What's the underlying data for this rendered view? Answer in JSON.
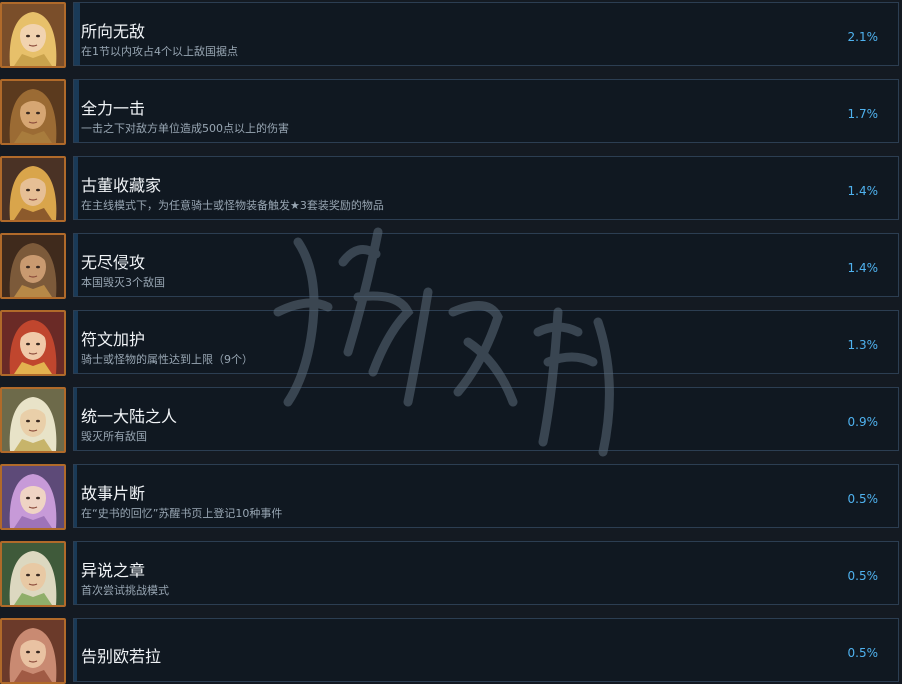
{
  "achievements": [
    {
      "title": "所向无敌",
      "description": "在1节以内攻占4个以上敌国据点",
      "percent": "2.1%",
      "progress": 0.021,
      "portrait": {
        "hair": "#e7c06a",
        "skin": "#f1d3b0",
        "bg": "#7a4e2a",
        "accent": "#c9a24c"
      }
    },
    {
      "title": "全力一击",
      "description": "一击之下对敌方单位造成500点以上的伤害",
      "percent": "1.7%",
      "progress": 0.017,
      "portrait": {
        "hair": "#9b6b34",
        "skin": "#d6a673",
        "bg": "#5b3a1e",
        "accent": "#a87c3d"
      }
    },
    {
      "title": "古董收藏家",
      "description": "在主线模式下，为任意骑士或怪物装备触发★3套装奖励的物品",
      "percent": "1.4%",
      "progress": 0.014,
      "portrait": {
        "hair": "#d9a54b",
        "skin": "#e6bf95",
        "bg": "#4a3225",
        "accent": "#8c5a2c"
      }
    },
    {
      "title": "无尽侵攻",
      "description": "本国毁灭3个敌国",
      "percent": "1.4%",
      "progress": 0.014,
      "portrait": {
        "hair": "#7c5a3a",
        "skin": "#c99a70",
        "bg": "#3f2a1c",
        "accent": "#b78947"
      }
    },
    {
      "title": "符文加护",
      "description": "骑士或怪物的属性达到上限（9个）",
      "percent": "1.3%",
      "progress": 0.013,
      "portrait": {
        "hair": "#c0462e",
        "skin": "#f0c9a8",
        "bg": "#6a2a26",
        "accent": "#e3b24f"
      }
    },
    {
      "title": "统一大陆之人",
      "description": "毁灭所有敌国",
      "percent": "0.9%",
      "progress": 0.009,
      "portrait": {
        "hair": "#e8e3c8",
        "skin": "#e9cfa9",
        "bg": "#6d6a4a",
        "accent": "#c7b46a"
      }
    },
    {
      "title": "故事片断",
      "description": "在“史书的回忆”苏醒书页上登记10种事件",
      "percent": "0.5%",
      "progress": 0.005,
      "portrait": {
        "hair": "#c79ad8",
        "skin": "#efd4c4",
        "bg": "#5d4a78",
        "accent": "#9e73b8"
      }
    },
    {
      "title": "异说之章",
      "description": "首次尝试挑战模式",
      "percent": "0.5%",
      "progress": 0.005,
      "portrait": {
        "hair": "#dcd8c0",
        "skin": "#e8c9a4",
        "bg": "#3f5a3a",
        "accent": "#8fae6a"
      }
    },
    {
      "title": "告别欧若拉",
      "description": "",
      "percent": "0.5%",
      "progress": 0.005,
      "portrait": {
        "hair": "#c98a72",
        "skin": "#e9c2a2",
        "bg": "#6b3a2a",
        "accent": "#a05a44"
      }
    }
  ],
  "colors": {
    "background": "#141a22",
    "card": "#101821",
    "card_border": "#2c3e52",
    "progress": "#1a3a57",
    "percent_text": "#4fb2ef",
    "avatar_border": "#b06a2a"
  }
}
